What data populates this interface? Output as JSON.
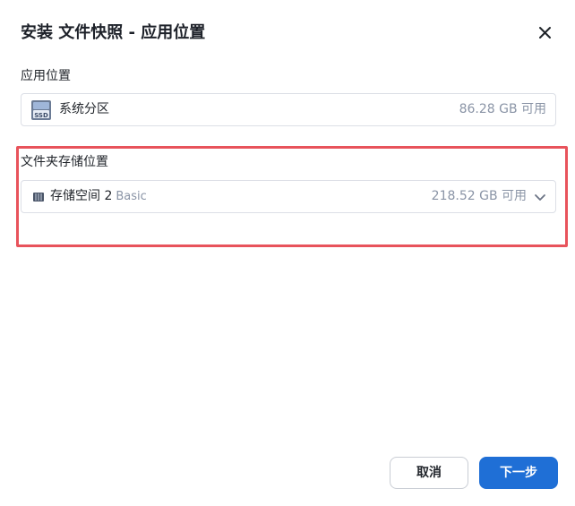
{
  "dialog": {
    "title": "安装 文件快照 - 应用位置"
  },
  "app_location": {
    "label": "应用位置",
    "volume_name": "系统分区",
    "available": "86.28 GB 可用",
    "icon": "ssd-drive-icon",
    "icon_text": "SSD"
  },
  "folder_location": {
    "label": "文件夹存储位置",
    "volume_name": "存储空间 2",
    "volume_type": "Basic",
    "available": "218.52 GB 可用",
    "icon": "storage-pool-icon"
  },
  "footer": {
    "cancel_label": "取消",
    "next_label": "下一步"
  },
  "colors": {
    "primary": "#1f6fd6",
    "highlight": "#e8535b",
    "muted_text": "#8a94a6"
  }
}
